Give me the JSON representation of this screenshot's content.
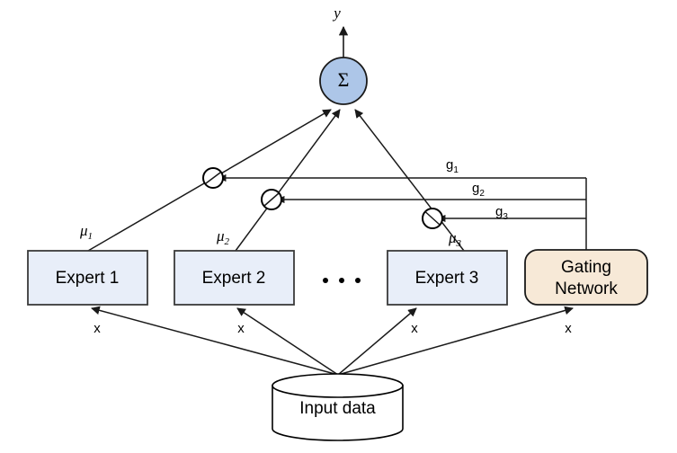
{
  "diagram": {
    "title_output": "y",
    "sum_node": {
      "label": "Σ",
      "name": "summation-node"
    },
    "experts": [
      {
        "label": "Expert 1",
        "input_label": "x",
        "output_label": "μ",
        "output_sub": "1",
        "gate_label": "g",
        "gate_sub": "1"
      },
      {
        "label": "Expert 2",
        "input_label": "x",
        "output_label": "μ",
        "output_sub": "2",
        "gate_label": "g",
        "gate_sub": "2"
      },
      {
        "label": "Expert 3",
        "input_label": "x",
        "output_label": "μ",
        "output_sub": "3",
        "gate_label": "g",
        "gate_sub": "3"
      }
    ],
    "ellipsis": "• • •",
    "gating": {
      "line1": "Gating",
      "line2": "Network",
      "input_label": "x"
    },
    "datastore": {
      "label": "Input data"
    },
    "colors": {
      "expert_fill": "#e8eef9",
      "gating_fill": "#f7e9d7",
      "sum_fill": "#adc6e8",
      "stroke": "#1a1a1a",
      "background": "#ffffff"
    }
  }
}
